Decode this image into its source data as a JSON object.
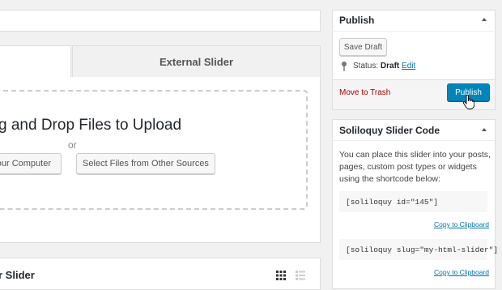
{
  "editor": {
    "tabs": [
      {
        "label": ""
      },
      {
        "label": "External Slider"
      }
    ],
    "upload": {
      "title": "g and Drop Files to Upload",
      "or_text": "or",
      "computer_button": "our Computer",
      "sources_button": "Select Files from Other Sources"
    },
    "slider_section": {
      "title": "r Slider"
    }
  },
  "publish_box": {
    "title": "Publish",
    "save_draft": "Save Draft",
    "status_label": "Status:",
    "status_value": "Draft",
    "edit_link": "Edit",
    "trash_link": "Move to Trash",
    "publish_button": "Publish"
  },
  "code_box": {
    "title": "Soliloquy Slider Code",
    "description": "You can place this slider into your posts, pages, custom post types or widgets using the shortcode below:",
    "shortcodes": [
      {
        "code": "[soliloquy id=\"145\"]",
        "copy_label": "Copy to Clipboard"
      },
      {
        "code": "[soliloquy slug=\"my-html-slider\"]",
        "copy_label": "Copy to Clipboard"
      }
    ]
  },
  "colors": {
    "primary": "#0085ba",
    "link": "#0073aa",
    "danger": "#a00000"
  }
}
